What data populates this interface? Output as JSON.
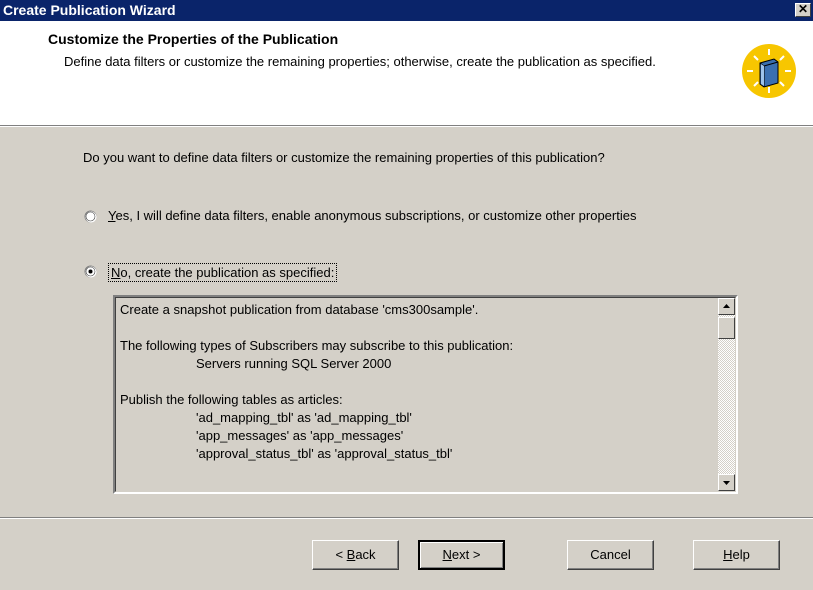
{
  "window": {
    "title": "Create Publication Wizard",
    "close_glyph": "✕"
  },
  "header": {
    "title": "Customize the Properties of the Publication",
    "description": "Define data filters or customize the remaining properties; otherwise, create the publication as specified.",
    "icon": "wizard-book-icon",
    "icon_color": "#f7c600"
  },
  "question": "Do you want to define data filters or customize the remaining properties of this publication?",
  "options": [
    {
      "mnemonic": "Y",
      "rest": "es, I will define data filters, enable anonymous subscriptions, or customize other properties",
      "selected": false
    },
    {
      "mnemonic": "N",
      "rest": "o, create the publication as specified:",
      "selected": true
    }
  ],
  "summary": {
    "line1": "Create a snapshot publication from database 'cms300sample'.",
    "line2": "The following types of Subscribers may subscribe to this publication:",
    "line3": "Servers running SQL Server 2000",
    "line4": "Publish the following tables as articles:",
    "articles": [
      "'ad_mapping_tbl' as 'ad_mapping_tbl'",
      "'app_messages' as 'app_messages'",
      "'approval_status_tbl' as 'approval_status_tbl'"
    ]
  },
  "buttons": {
    "back_pre": "< ",
    "back_mn": "B",
    "back_rest": "ack",
    "next_mn": "N",
    "next_rest": "ext >",
    "cancel": "Cancel",
    "help_mn": "H",
    "help_rest": "elp"
  }
}
